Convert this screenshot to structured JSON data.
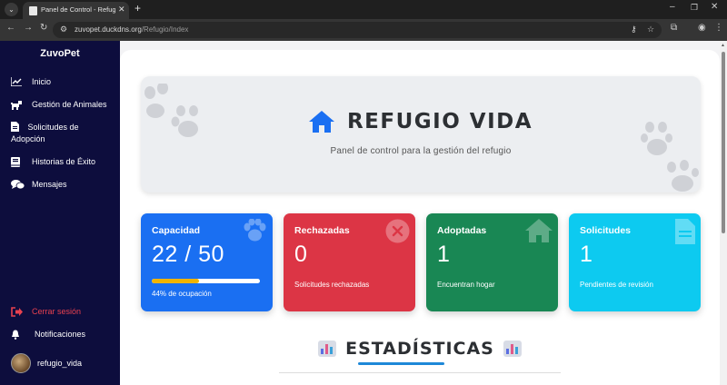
{
  "browser": {
    "tab_title": "Panel de Control - Refugio - ZuvoPet",
    "url_host": "zuvopet.duckdns.org",
    "url_path": "/Refugio/Index"
  },
  "sidebar": {
    "brand": "ZuvoPet",
    "items": [
      {
        "label": "Inicio",
        "icon": "chart-line-icon"
      },
      {
        "label": "Gestión de Animales",
        "icon": "dog-icon"
      },
      {
        "label": "Solicitudes de Adopción",
        "icon": "file-icon"
      },
      {
        "label": "Historias de Éxito",
        "icon": "book-icon"
      },
      {
        "label": "Mensajes",
        "icon": "comments-icon"
      }
    ],
    "logout": "Cerrar sesión",
    "notifications": "Notificaciones",
    "username": "refugio_vida"
  },
  "hero": {
    "title": "REFUGIO VIDA",
    "subtitle": "Panel de control para la gestión del refugio"
  },
  "stats": [
    {
      "title": "Capacidad",
      "value": "22 / 50",
      "description": "44% de ocupación",
      "progress": 0.44,
      "color": "#1a6ff2",
      "icon": "paw-icon"
    },
    {
      "title": "Rechazadas",
      "value": "0",
      "description": "Solicitudes rechazadas",
      "color": "#dc3545",
      "icon": "x-circle-icon"
    },
    {
      "title": "Adoptadas",
      "value": "1",
      "description": "Encuentran hogar",
      "color": "#198754",
      "icon": "home-icon"
    },
    {
      "title": "Solicitudes",
      "value": "1",
      "description": "Pendientes de revisión",
      "color": "#0dcaf0",
      "icon": "document-icon"
    }
  ],
  "section_heading": "ESTADÍSTICAS"
}
